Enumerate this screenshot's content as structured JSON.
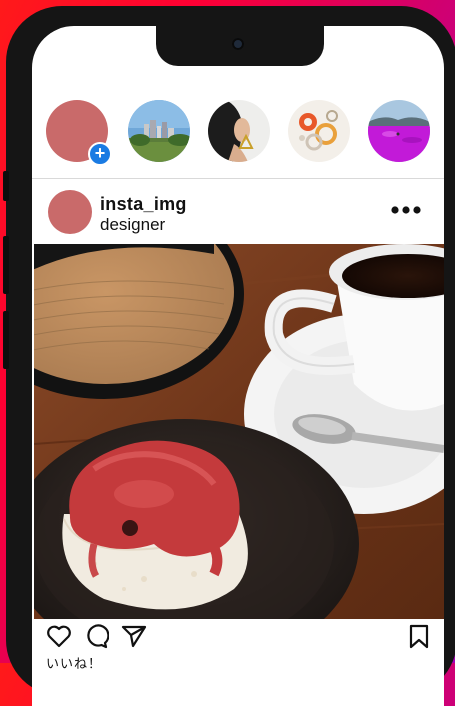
{
  "stories": [
    {
      "name": "story-own",
      "has_add_badge": true,
      "add_badge": "+"
    },
    {
      "name": "story-city"
    },
    {
      "name": "story-person"
    },
    {
      "name": "story-rings"
    },
    {
      "name": "story-purple"
    }
  ],
  "post": {
    "username": "insta_img",
    "subtitle": "designer",
    "more_icon": "more-dots-icon",
    "likes_label": "いいね！"
  },
  "actions": {
    "like_icon": "heart-icon",
    "comment_icon": "comment-icon",
    "share_icon": "send-icon",
    "save_icon": "bookmark-icon"
  },
  "colors": {
    "background_gradient": [
      "#ff1a1a",
      "#d4006a",
      "#a300b5"
    ],
    "avatar": "#c96a6a",
    "add_badge": "#1a7be3"
  }
}
